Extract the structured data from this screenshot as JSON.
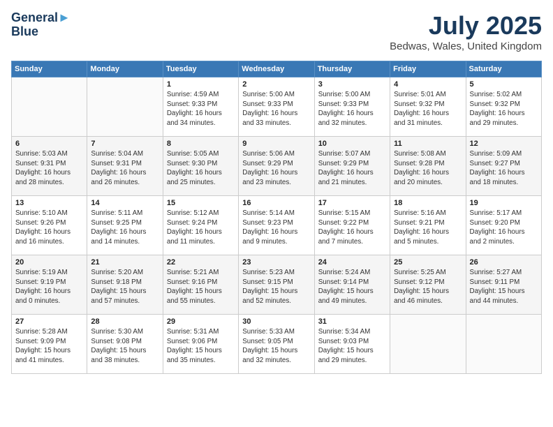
{
  "header": {
    "logo_line1": "General",
    "logo_line2": "Blue",
    "title": "July 2025",
    "subtitle": "Bedwas, Wales, United Kingdom"
  },
  "weekdays": [
    "Sunday",
    "Monday",
    "Tuesday",
    "Wednesday",
    "Thursday",
    "Friday",
    "Saturday"
  ],
  "weeks": [
    [
      {
        "day": "",
        "detail": ""
      },
      {
        "day": "",
        "detail": ""
      },
      {
        "day": "1",
        "detail": "Sunrise: 4:59 AM\nSunset: 9:33 PM\nDaylight: 16 hours\nand 34 minutes."
      },
      {
        "day": "2",
        "detail": "Sunrise: 5:00 AM\nSunset: 9:33 PM\nDaylight: 16 hours\nand 33 minutes."
      },
      {
        "day": "3",
        "detail": "Sunrise: 5:00 AM\nSunset: 9:33 PM\nDaylight: 16 hours\nand 32 minutes."
      },
      {
        "day": "4",
        "detail": "Sunrise: 5:01 AM\nSunset: 9:32 PM\nDaylight: 16 hours\nand 31 minutes."
      },
      {
        "day": "5",
        "detail": "Sunrise: 5:02 AM\nSunset: 9:32 PM\nDaylight: 16 hours\nand 29 minutes."
      }
    ],
    [
      {
        "day": "6",
        "detail": "Sunrise: 5:03 AM\nSunset: 9:31 PM\nDaylight: 16 hours\nand 28 minutes."
      },
      {
        "day": "7",
        "detail": "Sunrise: 5:04 AM\nSunset: 9:31 PM\nDaylight: 16 hours\nand 26 minutes."
      },
      {
        "day": "8",
        "detail": "Sunrise: 5:05 AM\nSunset: 9:30 PM\nDaylight: 16 hours\nand 25 minutes."
      },
      {
        "day": "9",
        "detail": "Sunrise: 5:06 AM\nSunset: 9:29 PM\nDaylight: 16 hours\nand 23 minutes."
      },
      {
        "day": "10",
        "detail": "Sunrise: 5:07 AM\nSunset: 9:29 PM\nDaylight: 16 hours\nand 21 minutes."
      },
      {
        "day": "11",
        "detail": "Sunrise: 5:08 AM\nSunset: 9:28 PM\nDaylight: 16 hours\nand 20 minutes."
      },
      {
        "day": "12",
        "detail": "Sunrise: 5:09 AM\nSunset: 9:27 PM\nDaylight: 16 hours\nand 18 minutes."
      }
    ],
    [
      {
        "day": "13",
        "detail": "Sunrise: 5:10 AM\nSunset: 9:26 PM\nDaylight: 16 hours\nand 16 minutes."
      },
      {
        "day": "14",
        "detail": "Sunrise: 5:11 AM\nSunset: 9:25 PM\nDaylight: 16 hours\nand 14 minutes."
      },
      {
        "day": "15",
        "detail": "Sunrise: 5:12 AM\nSunset: 9:24 PM\nDaylight: 16 hours\nand 11 minutes."
      },
      {
        "day": "16",
        "detail": "Sunrise: 5:14 AM\nSunset: 9:23 PM\nDaylight: 16 hours\nand 9 minutes."
      },
      {
        "day": "17",
        "detail": "Sunrise: 5:15 AM\nSunset: 9:22 PM\nDaylight: 16 hours\nand 7 minutes."
      },
      {
        "day": "18",
        "detail": "Sunrise: 5:16 AM\nSunset: 9:21 PM\nDaylight: 16 hours\nand 5 minutes."
      },
      {
        "day": "19",
        "detail": "Sunrise: 5:17 AM\nSunset: 9:20 PM\nDaylight: 16 hours\nand 2 minutes."
      }
    ],
    [
      {
        "day": "20",
        "detail": "Sunrise: 5:19 AM\nSunset: 9:19 PM\nDaylight: 16 hours\nand 0 minutes."
      },
      {
        "day": "21",
        "detail": "Sunrise: 5:20 AM\nSunset: 9:18 PM\nDaylight: 15 hours\nand 57 minutes."
      },
      {
        "day": "22",
        "detail": "Sunrise: 5:21 AM\nSunset: 9:16 PM\nDaylight: 15 hours\nand 55 minutes."
      },
      {
        "day": "23",
        "detail": "Sunrise: 5:23 AM\nSunset: 9:15 PM\nDaylight: 15 hours\nand 52 minutes."
      },
      {
        "day": "24",
        "detail": "Sunrise: 5:24 AM\nSunset: 9:14 PM\nDaylight: 15 hours\nand 49 minutes."
      },
      {
        "day": "25",
        "detail": "Sunrise: 5:25 AM\nSunset: 9:12 PM\nDaylight: 15 hours\nand 46 minutes."
      },
      {
        "day": "26",
        "detail": "Sunrise: 5:27 AM\nSunset: 9:11 PM\nDaylight: 15 hours\nand 44 minutes."
      }
    ],
    [
      {
        "day": "27",
        "detail": "Sunrise: 5:28 AM\nSunset: 9:09 PM\nDaylight: 15 hours\nand 41 minutes."
      },
      {
        "day": "28",
        "detail": "Sunrise: 5:30 AM\nSunset: 9:08 PM\nDaylight: 15 hours\nand 38 minutes."
      },
      {
        "day": "29",
        "detail": "Sunrise: 5:31 AM\nSunset: 9:06 PM\nDaylight: 15 hours\nand 35 minutes."
      },
      {
        "day": "30",
        "detail": "Sunrise: 5:33 AM\nSunset: 9:05 PM\nDaylight: 15 hours\nand 32 minutes."
      },
      {
        "day": "31",
        "detail": "Sunrise: 5:34 AM\nSunset: 9:03 PM\nDaylight: 15 hours\nand 29 minutes."
      },
      {
        "day": "",
        "detail": ""
      },
      {
        "day": "",
        "detail": ""
      }
    ]
  ]
}
